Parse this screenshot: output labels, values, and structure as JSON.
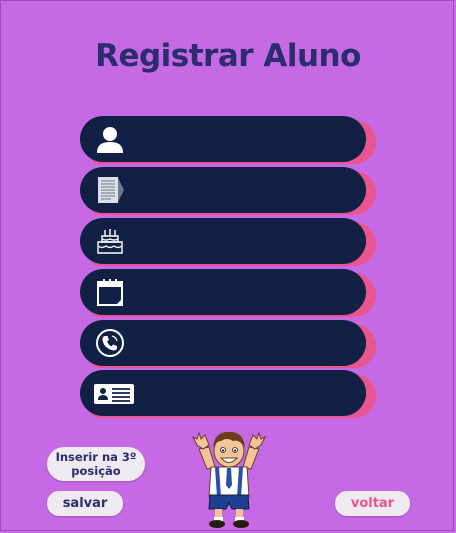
{
  "page": {
    "title": "Registrar Aluno"
  },
  "form": {
    "fields": [
      {
        "name": "nome",
        "icon": "user-icon",
        "value": ""
      },
      {
        "name": "documento",
        "icon": "document-icon",
        "value": ""
      },
      {
        "name": "aniversario",
        "icon": "birthday-cake-icon",
        "value": ""
      },
      {
        "name": "data",
        "icon": "calendar-icon",
        "value": ""
      },
      {
        "name": "telefone",
        "icon": "phone-icon",
        "value": ""
      },
      {
        "name": "identidade",
        "icon": "id-card-icon",
        "value": ""
      }
    ]
  },
  "actions": {
    "insert_label": "Inserir na 3º posição",
    "save_label": "salvar",
    "back_label": "voltar"
  },
  "colors": {
    "background": "#c56ae4",
    "field": "#132046",
    "field_accent": "#e8558f",
    "title": "#2b2d6e",
    "button": "#eeeaf0",
    "back_text": "#e8558f"
  },
  "illustration": {
    "icon": "schoolboy-illustration"
  }
}
